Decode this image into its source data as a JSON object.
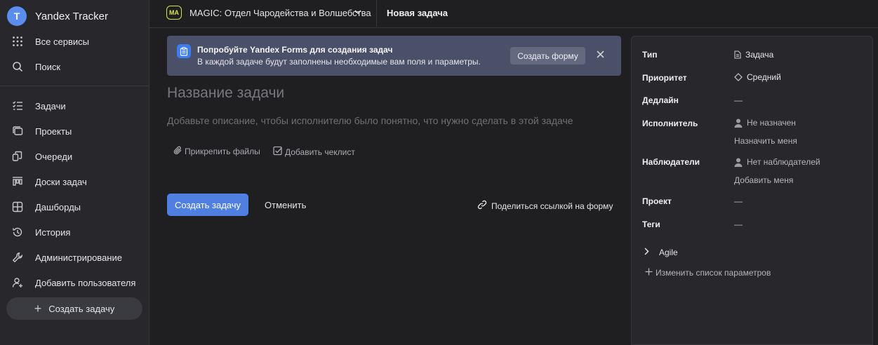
{
  "app": {
    "name": "Yandex Tracker",
    "logo_letter": "T"
  },
  "sidebar": {
    "top_items": [
      {
        "label": "Все сервисы",
        "icon": "grid-icon"
      },
      {
        "label": "Поиск",
        "icon": "search-icon"
      }
    ],
    "items": [
      {
        "label": "Задачи",
        "icon": "tasks-icon"
      },
      {
        "label": "Проекты",
        "icon": "projects-icon"
      },
      {
        "label": "Очереди",
        "icon": "queues-icon"
      },
      {
        "label": "Доски задач",
        "icon": "boards-icon"
      },
      {
        "label": "Дашборды",
        "icon": "dashboards-icon"
      },
      {
        "label": "История",
        "icon": "history-icon"
      },
      {
        "label": "Администрирование",
        "icon": "admin-icon"
      },
      {
        "label": "Добавить пользователя",
        "icon": "add-user-icon"
      }
    ],
    "create_label": "Создать задачу"
  },
  "header": {
    "queue_badge": "MA",
    "queue_name": "MAGIC: Отдел Чародейства и Волшебства",
    "page_title": "Новая задача"
  },
  "banner": {
    "title": "Попробуйте Yandex Forms для создания задач",
    "text": "В каждой задаче будут заполнены необходимые вам поля и параметры.",
    "button": "Создать форму"
  },
  "form": {
    "title_placeholder": "Название задачи",
    "description_placeholder": "Добавьте описание, чтобы исполнителю было понятно, что нужно сделать в этой задаче",
    "attach_label": "Прикрепить файлы",
    "checklist_label": "Добавить чеклист",
    "submit_label": "Создать задачу",
    "cancel_label": "Отменить",
    "share_label": "Поделиться ссылкой на форму"
  },
  "params": {
    "type": {
      "label": "Тип",
      "value": "Задача"
    },
    "priority": {
      "label": "Приоритет",
      "value": "Средний"
    },
    "deadline": {
      "label": "Дедлайн",
      "value": "—"
    },
    "assignee": {
      "label": "Исполнитель",
      "value": "Не назначен",
      "action": "Назначить меня"
    },
    "followers": {
      "label": "Наблюдатели",
      "value": "Нет наблюдателей",
      "action": "Добавить меня"
    },
    "project": {
      "label": "Проект",
      "value": "—"
    },
    "tags": {
      "label": "Теги",
      "value": "—"
    },
    "agile_label": "Agile",
    "edit_label": "Изменить список параметров"
  },
  "colors": {
    "accent": "#4f7fe0",
    "queue_badge": "#d7e24a",
    "banner_bg": "#4a5068"
  }
}
